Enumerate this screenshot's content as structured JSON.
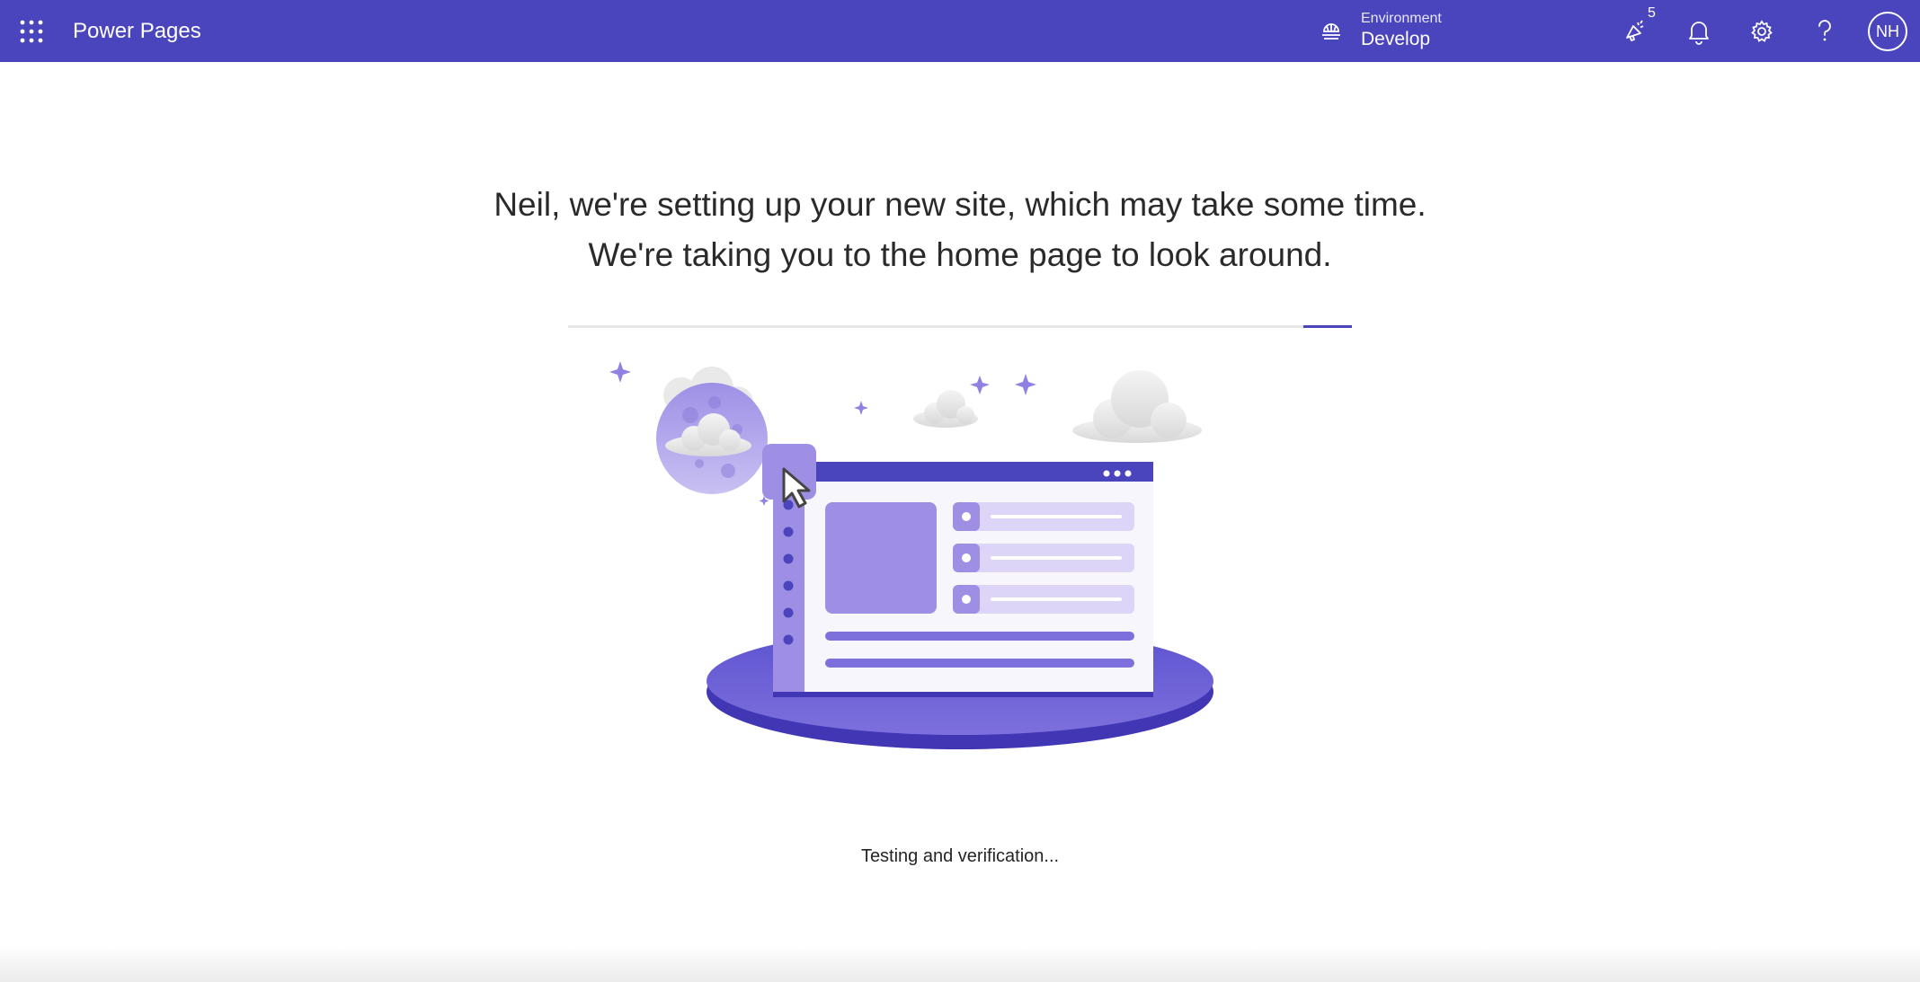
{
  "header": {
    "app_name": "Power Pages",
    "environment_label": "Environment",
    "environment_value": "Develop",
    "whats_new_count": "5",
    "avatar_initials": "NH",
    "icons": [
      "app-launcher-icon",
      "environment-icon",
      "megaphone-icon",
      "bell-icon",
      "gear-icon",
      "help-icon"
    ]
  },
  "main": {
    "headline_line1": "Neil, we're setting up your new site, which may take some time.",
    "headline_line2": "We're taking you to the home page to look around.",
    "status_text": "Testing and verification..."
  },
  "colors": {
    "brand": "#4a45bd",
    "accent_light": "#9b8fe3",
    "background": "#ffffff"
  }
}
